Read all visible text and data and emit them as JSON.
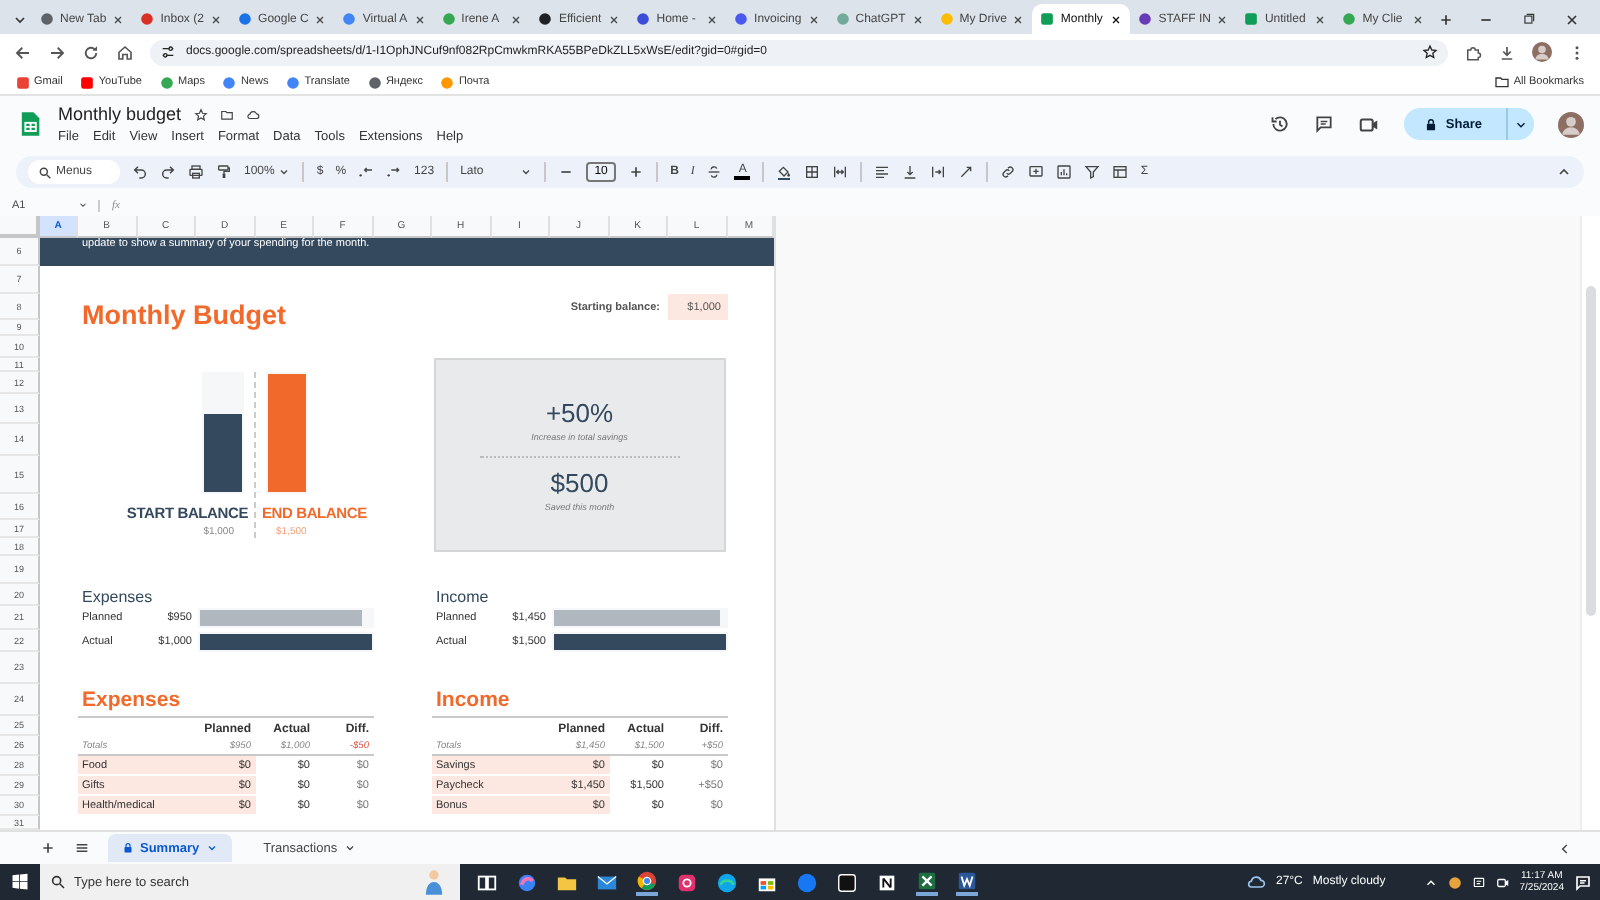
{
  "browser": {
    "tabs": [
      {
        "label": "New Tab",
        "selected": false
      },
      {
        "label": "Inbox (2",
        "selected": false
      },
      {
        "label": "Google C",
        "selected": false
      },
      {
        "label": "Virtual A",
        "selected": false
      },
      {
        "label": "Irene A",
        "selected": false
      },
      {
        "label": "Efficient",
        "selected": false
      },
      {
        "label": "Home -",
        "selected": false
      },
      {
        "label": "Invoicing",
        "selected": false
      },
      {
        "label": "ChatGPT",
        "selected": false
      },
      {
        "label": "My Drive",
        "selected": false
      },
      {
        "label": "Monthly",
        "selected": true
      },
      {
        "label": "STAFF IN",
        "selected": false
      },
      {
        "label": "Untitled",
        "selected": false
      },
      {
        "label": "My Clie",
        "selected": false
      }
    ],
    "address": "docs.google.com/spreadsheets/d/1-I1OphJNCuf9nf082RpCmwkmRKA55BPeDkZLL5xWsE/edit?gid=0#gid=0",
    "bookmarks": [
      "Gmail",
      "YouTube",
      "Maps",
      "News",
      "Translate",
      "Яндекс",
      "Почта"
    ],
    "all_bookmarks": "All Bookmarks"
  },
  "document": {
    "title": "Monthly budget",
    "menus": [
      "File",
      "Edit",
      "View",
      "Insert",
      "Format",
      "Data",
      "Tools",
      "Extensions",
      "Help"
    ],
    "share": "Share"
  },
  "toolbar": {
    "search": {
      "placeholder": "Menus"
    },
    "zoom": "100%",
    "currency": "$",
    "percent": "%",
    "number_format": "123",
    "font": "Lato",
    "font_size": "10",
    "bold": "B",
    "italic": "I",
    "text_color": "A",
    "functions": "Σ"
  },
  "formula_bar": {
    "cell": "A1",
    "function_label": "fx"
  },
  "sheet": {
    "columns": [
      {
        "label": "A",
        "selected": true
      },
      {
        "label": "B",
        "selected": false
      },
      {
        "label": "C",
        "selected": false
      },
      {
        "label": "D",
        "selected": false
      },
      {
        "label": "E",
        "selected": false
      },
      {
        "label": "F",
        "selected": false
      },
      {
        "label": "G",
        "selected": false
      },
      {
        "label": "H",
        "selected": false
      },
      {
        "label": "I",
        "selected": false
      },
      {
        "label": "J",
        "selected": false
      },
      {
        "label": "K",
        "selected": false
      },
      {
        "label": "L",
        "selected": false
      },
      {
        "label": "M",
        "selected": false
      }
    ],
    "rows": [
      "6",
      "7",
      "8",
      "9",
      "10",
      "11",
      "12",
      "13",
      "14",
      "15",
      "16",
      "17",
      "18",
      "19",
      "20",
      "21",
      "22",
      "23",
      "24",
      "25",
      "26",
      "28",
      "29",
      "30",
      "31"
    ],
    "banner": "update to show a summary of your spending for the month.",
    "title": "Monthly Budget",
    "starting_balance": {
      "label": "Starting balance:",
      "value": "$1,000"
    },
    "balances": [
      {
        "label": "START BALANCE",
        "value": "$1,000",
        "kind": "start",
        "level": 0.667
      },
      {
        "label": "END BALANCE",
        "value": "$1,500",
        "kind": "end",
        "level": 1
      }
    ],
    "savings": {
      "change": "+50%",
      "change_label": "Increase in total savings",
      "saved": "$500",
      "saved_label": "Saved this month"
    },
    "summaries": [
      {
        "title": "Expenses",
        "bars": [
          {
            "label": "Planned",
            "value": "$950",
            "kind": "planned",
            "level": 0.95
          },
          {
            "label": "Actual",
            "value": "$1,000",
            "kind": "actual",
            "level": 1
          }
        ]
      },
      {
        "title": "Income",
        "bars": [
          {
            "label": "Planned",
            "value": "$1,450",
            "kind": "planned",
            "level": 0.967
          },
          {
            "label": "Actual",
            "value": "$1,500",
            "kind": "actual",
            "level": 1
          }
        ]
      }
    ],
    "tables": [
      {
        "title": "Expenses",
        "columns": [
          "Planned",
          "Actual",
          "Diff."
        ],
        "totals": {
          "label": "Totals",
          "values": [
            {
              "text": "$950",
              "negative": false
            },
            {
              "text": "$1,000",
              "negative": false
            },
            {
              "text": "-$50",
              "negative": true
            }
          ]
        },
        "rows": [
          {
            "name": "Food",
            "values": [
              "$0",
              "$0",
              "$0"
            ]
          },
          {
            "name": "Gifts",
            "values": [
              "$0",
              "$0",
              "$0"
            ]
          },
          {
            "name": "Health/medical",
            "values": [
              "$0",
              "$0",
              "$0"
            ]
          }
        ]
      },
      {
        "title": "Income",
        "columns": [
          "Planned",
          "Actual",
          "Diff."
        ],
        "totals": {
          "label": "Totals",
          "values": [
            {
              "text": "$1,450",
              "negative": false
            },
            {
              "text": "$1,500",
              "negative": false
            },
            {
              "text": "+$50",
              "negative": false
            }
          ]
        },
        "rows": [
          {
            "name": "Savings",
            "values": [
              "$0",
              "$0",
              "$0"
            ]
          },
          {
            "name": "Paycheck",
            "values": [
              "$1,450",
              "$1,500",
              "+$50"
            ]
          },
          {
            "name": "Bonus",
            "values": [
              "$0",
              "$0",
              "$0"
            ]
          }
        ]
      }
    ]
  },
  "sheet_tabs": [
    {
      "label": "Summary",
      "selected": true,
      "locked": true
    },
    {
      "label": "Transactions",
      "selected": false,
      "locked": false
    }
  ],
  "taskbar": {
    "search": {
      "placeholder": "Type here to search"
    },
    "temperature": "27°C",
    "weather": "Mostly cloudy",
    "time": "11:17 AM",
    "date": "7/25/2024"
  }
}
